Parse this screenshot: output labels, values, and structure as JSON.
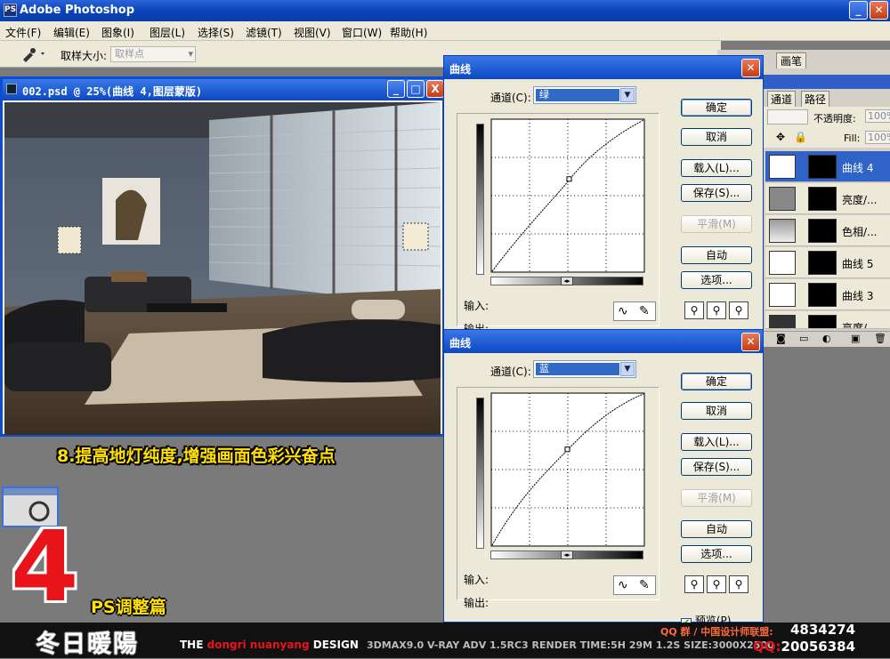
{
  "app": {
    "title": "Adobe Photoshop",
    "logo": "PS"
  },
  "menu": [
    {
      "label": "文件(F)"
    },
    {
      "label": "编辑(E)"
    },
    {
      "label": "图象(I)"
    },
    {
      "label": "图层(L)"
    },
    {
      "label": "选择(S)"
    },
    {
      "label": "滤镜(T)"
    },
    {
      "label": "视图(V)"
    },
    {
      "label": "窗口(W)"
    },
    {
      "label": "帮助(H)"
    }
  ],
  "options_bar": {
    "sample_size_label": "取样大小:",
    "sample_size_value": "取样点",
    "tool_icon": "eyedropper-icon"
  },
  "document": {
    "title": "002.psd @ 25%(曲线 4,图层蒙版)",
    "btn_min": "_",
    "btn_max": "□",
    "btn_close": "X"
  },
  "overlay": {
    "caption": "8.提高地灯纯度,增强画面色彩兴奋点",
    "step_number": "4",
    "section": "PS调整篇"
  },
  "footer": {
    "brand": "冬日暖陽",
    "tag_the": "THE ",
    "tag_name": "dongri nuanyang",
    "tag_design": " DESIGN",
    "specs": "3DMAX9.0  V-RAY ADV 1.5RC3   RENDER TIME:5H 29M 1.2S  SIZE:3000X2500",
    "qq_group_label": "QQ 群 / 中国设计师联盟:",
    "qq_group_num": "4834274",
    "qq_label": "QQ:",
    "qq_num": "20056384"
  },
  "palette": {
    "tab_brush": "画笔",
    "tab_channels": "通道",
    "tab_paths": "路径",
    "opacity_label": "不透明度:",
    "opacity_value": "100%",
    "fill_label": "Fill:",
    "fill_value": "100%",
    "layers": [
      {
        "name": "曲线 4",
        "selected": true
      },
      {
        "name": "亮度/...",
        "selected": false
      },
      {
        "name": "色相/...",
        "selected": false
      },
      {
        "name": "曲线 5",
        "selected": false
      },
      {
        "name": "曲线 3",
        "selected": false
      },
      {
        "name": "亮度/...",
        "selected": false
      }
    ]
  },
  "curves_dialogs": [
    {
      "title": "曲线",
      "channel_label": "通道(C):",
      "channel_value": "绿",
      "input_label": "输入:",
      "output_label": "输出:",
      "buttons": {
        "ok": "确定",
        "cancel": "取消",
        "load": "载入(L)...",
        "save": "保存(S)...",
        "smooth": "平滑(M)",
        "auto": "自动",
        "options": "选项..."
      }
    },
    {
      "title": "曲线",
      "channel_label": "通道(C):",
      "channel_value": "蓝",
      "input_label": "输入:",
      "output_label": "输出:",
      "preview_label": "预览(P)",
      "preview_checked": true,
      "buttons": {
        "ok": "确定",
        "cancel": "取消",
        "load": "载入(L)...",
        "save": "保存(S)...",
        "smooth": "平滑(M)",
        "auto": "自动",
        "options": "选项..."
      }
    }
  ]
}
